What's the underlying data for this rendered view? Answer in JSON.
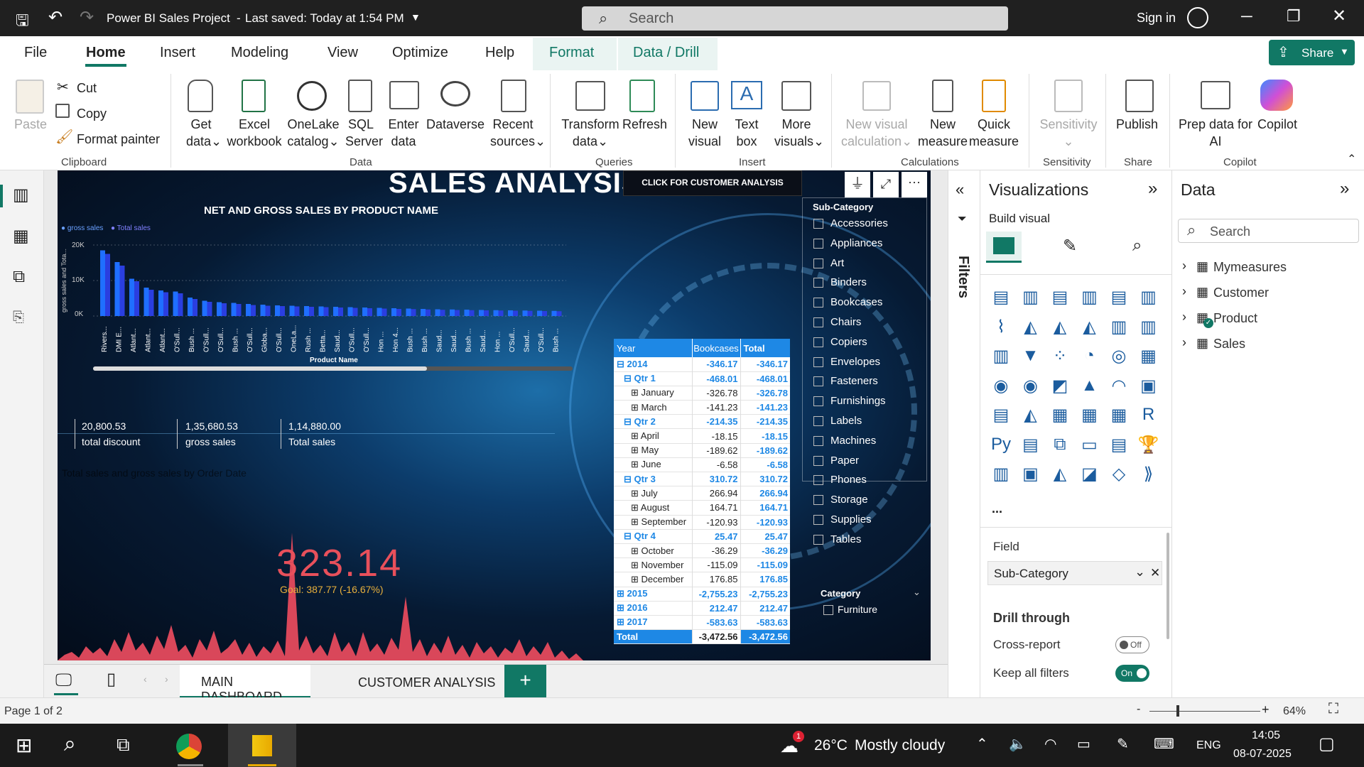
{
  "titlebar": {
    "title": "Power BI Sales Project",
    "saved": "Last saved: Today at 1:54 PM",
    "search_placeholder": "Search",
    "signin": "Sign in"
  },
  "menu": {
    "items": [
      "File",
      "Home",
      "Insert",
      "Modeling",
      "View",
      "Optimize",
      "Help",
      "Format",
      "Data / Drill"
    ],
    "share": "Share"
  },
  "ribbon": {
    "clipboard": {
      "paste": "Paste",
      "cut": "Cut",
      "copy": "Copy",
      "format_painter": "Format painter",
      "group": "Clipboard"
    },
    "data": {
      "get": "Get",
      "get2": "data",
      "excel": "Excel",
      "excel2": "workbook",
      "onelake": "OneLake",
      "onelake2": "catalog",
      "sql": "SQL",
      "sql2": "Server",
      "enter": "Enter",
      "enter2": "data",
      "dataverse": "Dataverse",
      "recent": "Recent",
      "recent2": "sources",
      "group": "Data"
    },
    "queries": {
      "transform": "Transform",
      "transform2": "data",
      "refresh": "Refresh",
      "group": "Queries"
    },
    "insert": {
      "newvisual": "New",
      "newvisual2": "visual",
      "textbox": "Text",
      "textbox2": "box",
      "more": "More",
      "more2": "visuals",
      "group": "Insert"
    },
    "calc": {
      "nvc": "New visual",
      "nvc2": "calculation",
      "nm": "New",
      "nm2": "measure",
      "qm": "Quick",
      "qm2": "measure",
      "group": "Calculations"
    },
    "sens": {
      "label": "Sensitivity",
      "group": "Sensitivity"
    },
    "share": {
      "publish": "Publish",
      "group": "Share"
    },
    "copilot": {
      "prep": "Prep data for",
      "prep2": "AI",
      "copilot": "Copilot",
      "group": "Copilot"
    }
  },
  "report": {
    "title": "SALES ANALYSIS",
    "customer_btn": "CLICK FOR CUSTOMER ANALYSIS",
    "bar_title": "NET AND GROSS SALES BY PRODUCT NAME",
    "legend1": "gross sales",
    "legend2": "Total sales",
    "ylabel": "gross sales and Tota...",
    "xlabel": "Product Name",
    "yticks": [
      "20K",
      "10K",
      "0K"
    ],
    "kpi": [
      {
        "value": "20,800.53",
        "label": "total discount"
      },
      {
        "value": "1,35,680.53",
        "label": "gross sales"
      },
      {
        "value": "1,14,880.00",
        "label": "Total sales"
      }
    ],
    "line_title": "Total sales and gross sales by Order Date",
    "big_kpi": "323.14",
    "goal": "Goal: 387.77 (-16.67%)",
    "slicer_title": "Sub-Category",
    "category_title": "Category",
    "category_item": "Furniture"
  },
  "chart_data": {
    "type": "bar",
    "title": "NET AND GROSS SALES BY PRODUCT NAME",
    "xlabel": "Product Name",
    "ylabel": "gross sales and Tota...",
    "ylim": [
      0,
      20000
    ],
    "categories": [
      "Rivers...",
      "DMI E...",
      "Atlant...",
      "Atlant...",
      "Atlant...",
      "O'Sull...",
      "Bush ...",
      "O'Sull...",
      "O'Sull...",
      "Bush ...",
      "O'Sull...",
      "Globa...",
      "O'Sull...",
      "OneLa...",
      "Rush ...",
      "Betta...",
      "Saud...",
      "O'Sull...",
      "O'Sull...",
      "Hon ...",
      "Hon 4...",
      "Bush ...",
      "Bush ...",
      "Saud...",
      "Saud...",
      "Bush ...",
      "Saud...",
      "Hon ...",
      "O'Sull...",
      "Saud...",
      "O'Sull...",
      "Bush ..."
    ],
    "series": [
      {
        "name": "gross sales",
        "values": [
          18500,
          15200,
          10500,
          8000,
          7200,
          6900,
          5200,
          4300,
          3900,
          3700,
          3400,
          3200,
          3000,
          2900,
          2800,
          2700,
          2600,
          2500,
          2400,
          2300,
          2200,
          2100,
          2000,
          1900,
          1850,
          1800,
          1700,
          1650,
          1600,
          1550,
          1500,
          1450
        ]
      },
      {
        "name": "Total sales",
        "values": [
          17500,
          14200,
          9800,
          7400,
          6700,
          6400,
          4800,
          4000,
          3600,
          3400,
          3100,
          2900,
          2800,
          2700,
          2600,
          2500,
          2400,
          2300,
          2200,
          2100,
          2000,
          1950,
          1850,
          1750,
          1700,
          1650,
          1600,
          1550,
          1500,
          1450,
          1400,
          1350
        ]
      }
    ]
  },
  "matrix": {
    "headers": [
      "Year",
      "Bookcases",
      "Total"
    ],
    "rows": [
      {
        "label": "2014",
        "v1": "-346.17",
        "v2": "-346.17",
        "lvl": 0,
        "sign": "⊟",
        "bold": true
      },
      {
        "label": "Qtr 1",
        "v1": "-468.01",
        "v2": "-468.01",
        "lvl": 1,
        "sign": "⊟",
        "bold": true
      },
      {
        "label": "January",
        "v1": "-326.78",
        "v2": "-326.78",
        "lvl": 2,
        "sign": "⊞",
        "bold": false
      },
      {
        "label": "March",
        "v1": "-141.23",
        "v2": "-141.23",
        "lvl": 2,
        "sign": "⊞",
        "bold": false
      },
      {
        "label": "Qtr 2",
        "v1": "-214.35",
        "v2": "-214.35",
        "lvl": 1,
        "sign": "⊟",
        "bold": true
      },
      {
        "label": "April",
        "v1": "-18.15",
        "v2": "-18.15",
        "lvl": 2,
        "sign": "⊞",
        "bold": false
      },
      {
        "label": "May",
        "v1": "-189.62",
        "v2": "-189.62",
        "lvl": 2,
        "sign": "⊞",
        "bold": false
      },
      {
        "label": "June",
        "v1": "-6.58",
        "v2": "-6.58",
        "lvl": 2,
        "sign": "⊞",
        "bold": false
      },
      {
        "label": "Qtr 3",
        "v1": "310.72",
        "v2": "310.72",
        "lvl": 1,
        "sign": "⊟",
        "bold": true
      },
      {
        "label": "July",
        "v1": "266.94",
        "v2": "266.94",
        "lvl": 2,
        "sign": "⊞",
        "bold": false
      },
      {
        "label": "August",
        "v1": "164.71",
        "v2": "164.71",
        "lvl": 2,
        "sign": "⊞",
        "bold": false
      },
      {
        "label": "September",
        "v1": "-120.93",
        "v2": "-120.93",
        "lvl": 2,
        "sign": "⊞",
        "bold": false
      },
      {
        "label": "Qtr 4",
        "v1": "25.47",
        "v2": "25.47",
        "lvl": 1,
        "sign": "⊟",
        "bold": true
      },
      {
        "label": "October",
        "v1": "-36.29",
        "v2": "-36.29",
        "lvl": 2,
        "sign": "⊞",
        "bold": false
      },
      {
        "label": "November",
        "v1": "-115.09",
        "v2": "-115.09",
        "lvl": 2,
        "sign": "⊞",
        "bold": false
      },
      {
        "label": "December",
        "v1": "176.85",
        "v2": "176.85",
        "lvl": 2,
        "sign": "⊞",
        "bold": false
      },
      {
        "label": "2015",
        "v1": "-2,755.23",
        "v2": "-2,755.23",
        "lvl": 0,
        "sign": "⊞",
        "bold": true
      },
      {
        "label": "2016",
        "v1": "212.47",
        "v2": "212.47",
        "lvl": 0,
        "sign": "⊞",
        "bold": true
      },
      {
        "label": "2017",
        "v1": "-583.63",
        "v2": "-583.63",
        "lvl": 0,
        "sign": "⊞",
        "bold": true
      },
      {
        "label": "Total",
        "v1": "-3,472.56",
        "v2": "-3,472.56",
        "lvl": 0,
        "sign": "",
        "bold": true
      }
    ]
  },
  "slicer": {
    "items": [
      "Accessories",
      "Appliances",
      "Art",
      "Binders",
      "Bookcases",
      "Chairs",
      "Copiers",
      "Envelopes",
      "Fasteners",
      "Furnishings",
      "Labels",
      "Machines",
      "Paper",
      "Phones",
      "Storage",
      "Supplies",
      "Tables"
    ]
  },
  "tabs": {
    "main": "MAIN DASHBOARD",
    "customer": "CUSTOMER ANALYSIS",
    "add": "+"
  },
  "status": {
    "page": "Page 1 of 2",
    "zoom": "64%",
    "zoom_minus": "-",
    "zoom_plus": "+"
  },
  "filters": {
    "label": "Filters"
  },
  "viz": {
    "title": "Visualizations",
    "build": "Build visual",
    "field": "Field",
    "field_value": "Sub-Category",
    "drill": "Drill through",
    "cross": "Cross-report",
    "cross_state": "Off",
    "keep": "Keep all filters",
    "keep_state": "On",
    "more": "..."
  },
  "datapane": {
    "title": "Data",
    "search": "Search",
    "tables": [
      "Mymeasures",
      "Customer",
      "Product",
      "Sales"
    ]
  },
  "taskbar": {
    "temp": "26°C",
    "weather": "Mostly cloudy",
    "lang": "ENG",
    "time": "14:05",
    "date": "08-07-2025",
    "badge": "1"
  },
  "colors": {
    "accent": "#117865",
    "bar_gross": "#1f6fff",
    "bar_total": "#2a3ee0",
    "spark": "#d9475a",
    "kpi": "#e8505b",
    "goal": "#e8b03c",
    "matrix_header": "#1e88e5"
  }
}
